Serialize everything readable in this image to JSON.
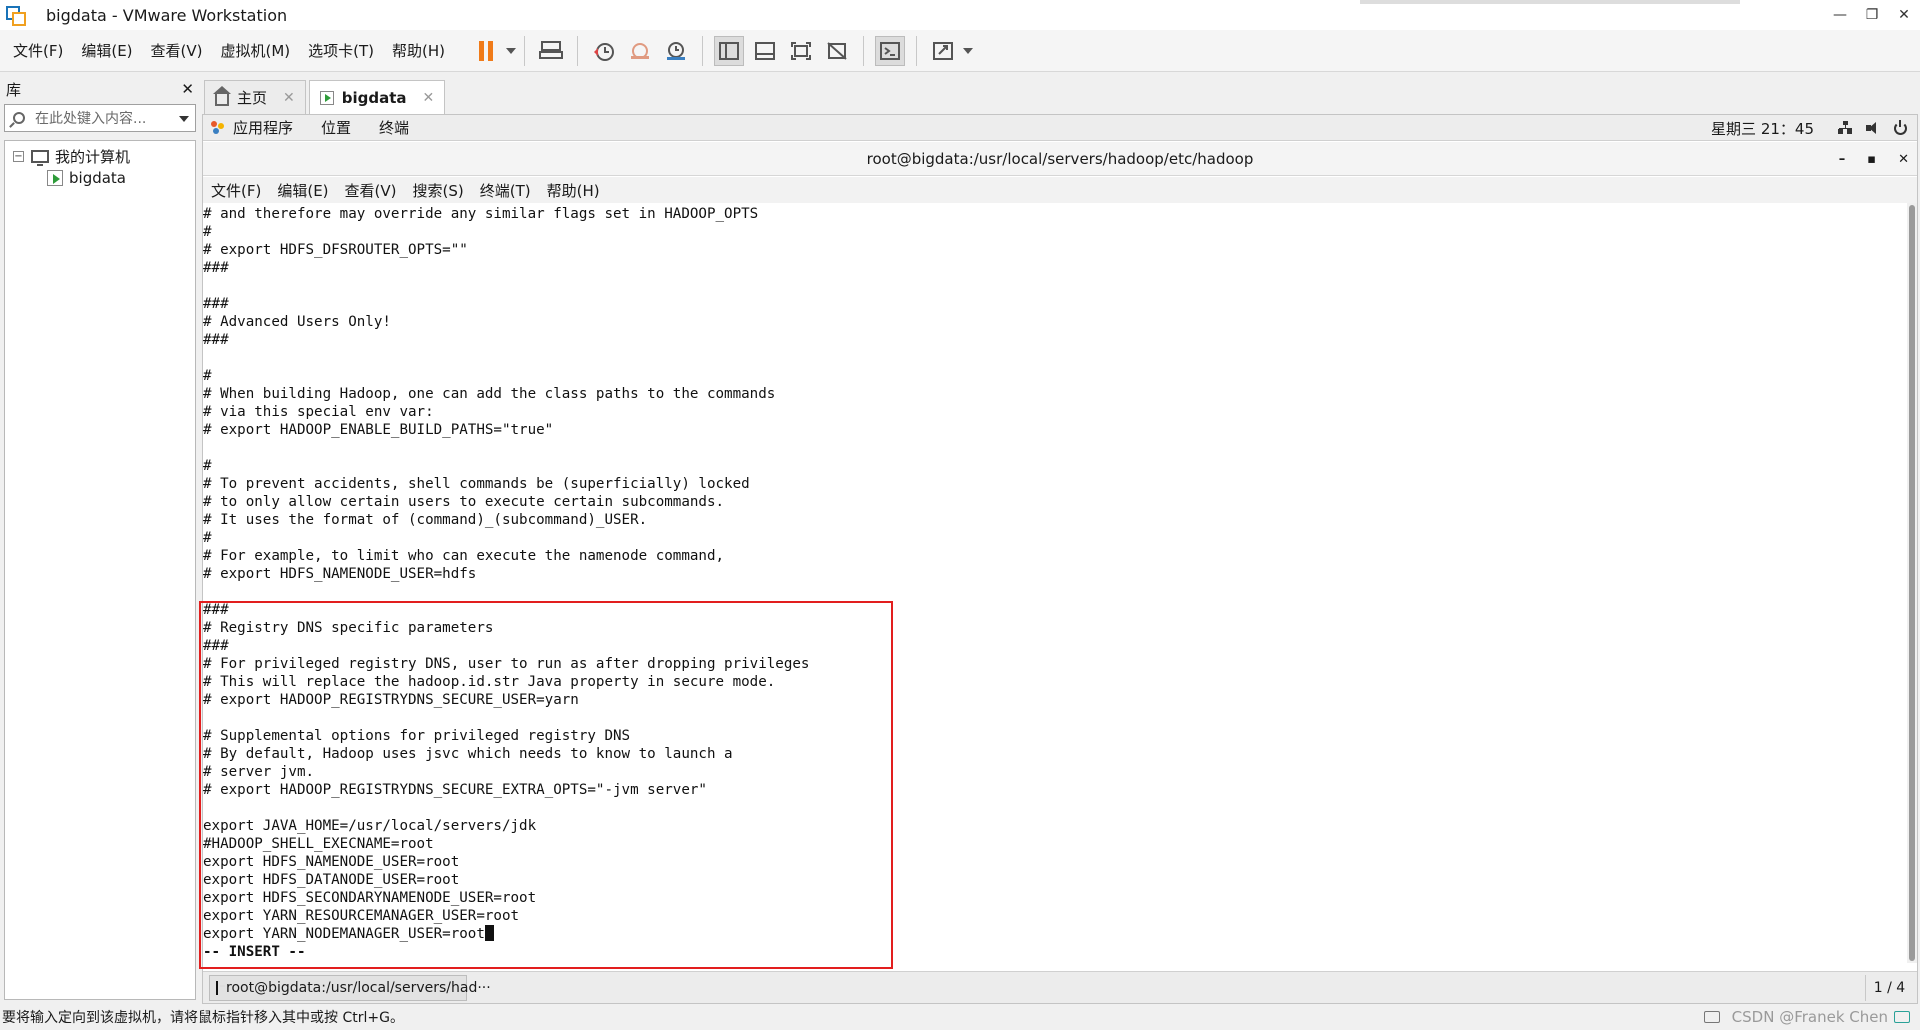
{
  "window": {
    "title": "bigdata - VMware Workstation",
    "controls": [
      "—",
      "❐",
      "✕"
    ]
  },
  "menubar": {
    "items": [
      "文件(F)",
      "编辑(E)",
      "查看(V)",
      "虚拟机(M)",
      "选项卡(T)",
      "帮助(H)"
    ]
  },
  "library": {
    "title": "库",
    "close": "✕",
    "search_placeholder": "在此处键入内容...",
    "tree_toggle": "−",
    "root": "我的计算机",
    "vm": "bigdata"
  },
  "tabs": [
    {
      "label": "主页",
      "close": "✕"
    },
    {
      "label": "bigdata",
      "close": "✕"
    }
  ],
  "gnome": {
    "apps": "应用程序",
    "places": "位置",
    "terminal": "终端",
    "clock": "星期三 21：45"
  },
  "terminal": {
    "title": "root@bigdata:/usr/local/servers/hadoop/etc/hadoop",
    "controls": [
      "–",
      "▪",
      "✕"
    ],
    "menu": [
      "文件(F)",
      "编辑(E)",
      "查看(V)",
      "搜索(S)",
      "终端(T)",
      "帮助(H)"
    ],
    "lines": [
      "# and therefore may override any similar flags set in HADOOP_OPTS",
      "#",
      "# export HDFS_DFSROUTER_OPTS=\"\"",
      "###",
      "",
      "###",
      "# Advanced Users Only!",
      "###",
      "",
      "#",
      "# When building Hadoop, one can add the class paths to the commands",
      "# via this special env var:",
      "# export HADOOP_ENABLE_BUILD_PATHS=\"true\"",
      "",
      "#",
      "# To prevent accidents, shell commands be (superficially) locked",
      "# to only allow certain users to execute certain subcommands.",
      "# It uses the format of (command)_(subcommand)_USER.",
      "#",
      "# For example, to limit who can execute the namenode command,",
      "# export HDFS_NAMENODE_USER=hdfs",
      "",
      "###",
      "# Registry DNS specific parameters",
      "###",
      "# For privileged registry DNS, user to run as after dropping privileges",
      "# This will replace the hadoop.id.str Java property in secure mode.",
      "# export HADOOP_REGISTRYDNS_SECURE_USER=yarn",
      "",
      "# Supplemental options for privileged registry DNS",
      "# By default, Hadoop uses jsvc which needs to know to launch a",
      "# server jvm.",
      "# export HADOOP_REGISTRYDNS_SECURE_EXTRA_OPTS=\"-jvm server\"",
      "",
      "export JAVA_HOME=/usr/local/servers/jdk",
      "#HADOOP_SHELL_EXECNAME=root",
      "export HDFS_NAMENODE_USER=root",
      "export HDFS_DATANODE_USER=root",
      "export HDFS_SECONDARYNAMENODE_USER=root",
      "export YARN_RESOURCEMANAGER_USER=root",
      "export YARN_NODEMANAGER_USER=root"
    ],
    "mode_line": "-- INSERT --",
    "task_label": "root@bigdata:/usr/local/servers/had···",
    "pager": "1 / 4"
  },
  "statusbar": {
    "message": "要将输入定向到该虚拟机，请将鼠标指针移入其中或按 Ctrl+G。",
    "watermark": "CSDN @Franek Chen"
  }
}
